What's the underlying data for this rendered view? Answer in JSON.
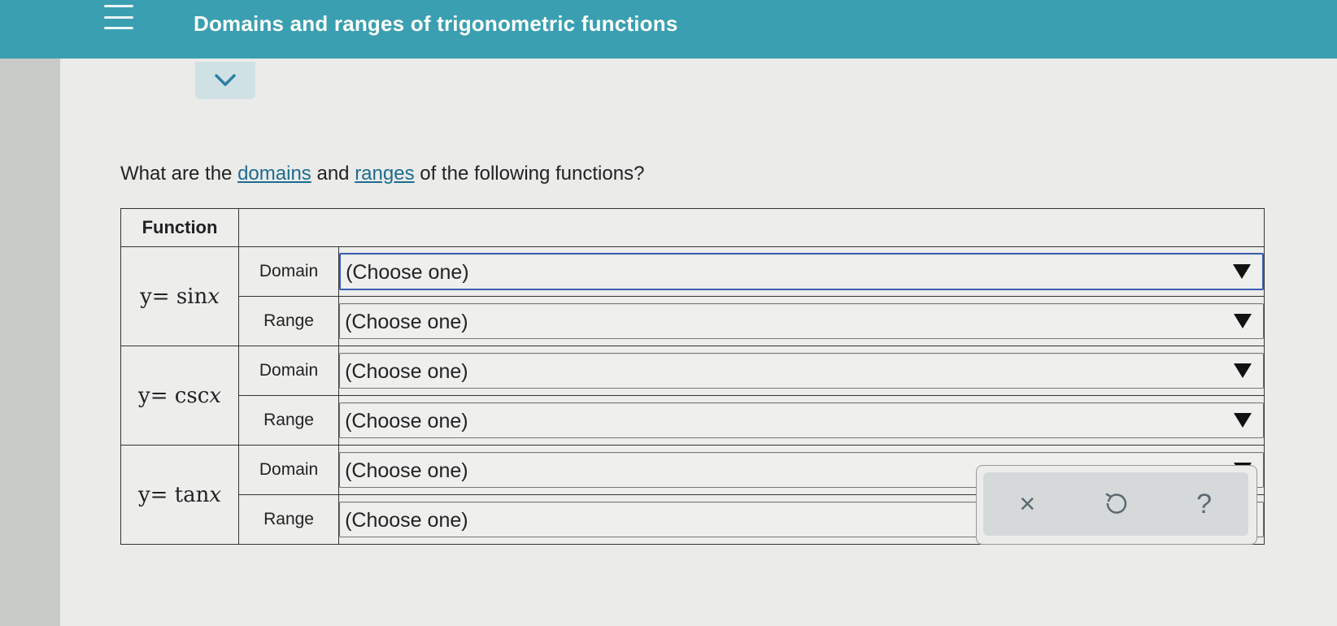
{
  "header": {
    "title": "Domains and ranges of trigonometric functions"
  },
  "question": {
    "prefix": "What are the ",
    "link_domains": "domains",
    "middle": " and ",
    "link_ranges": "ranges",
    "suffix": " of the following functions?"
  },
  "table": {
    "header_function": "Function",
    "rows": [
      {
        "func_prefix": "y= sin",
        "func_var": "x",
        "domain_label": "Domain",
        "domain_value": "(Choose one)",
        "range_label": "Range",
        "range_value": "(Choose one)"
      },
      {
        "func_prefix": "y= csc",
        "func_var": "x",
        "domain_label": "Domain",
        "domain_value": "(Choose one)",
        "range_label": "Range",
        "range_value": "(Choose one)"
      },
      {
        "func_prefix": "y= tan",
        "func_var": "x",
        "domain_label": "Domain",
        "domain_value": "(Choose one)",
        "range_label": "Range",
        "range_value": "(Choose one)"
      }
    ]
  },
  "actions": {
    "clear_glyph": "×",
    "help_glyph": "?"
  },
  "icons": {
    "menu": "hamburger-menu-icon",
    "collapse": "chevron-down-icon",
    "clear": "close-icon",
    "undo": "undo-icon",
    "help": "help-icon",
    "dropdown": "triangle-down-icon"
  },
  "colors": {
    "header_bg": "#3a9fb0",
    "link": "#1d6c90",
    "focus_border": "#3b5fb0"
  }
}
